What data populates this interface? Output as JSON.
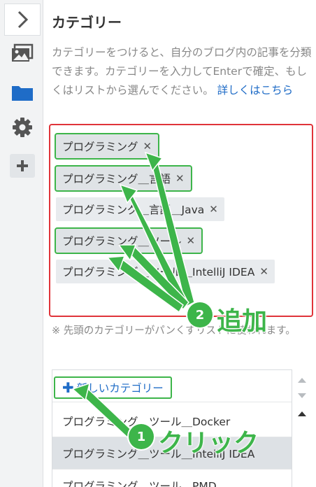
{
  "panel": {
    "title": "カテゴリー",
    "description": "カテゴリーをつけると、自分のブログ内の記事を分類できます。カテゴリーを入力してEnterで確定、もしくはリストから選んでください。",
    "help_link": "詳しくはこちら",
    "note": "※ 先頭のカテゴリーがパンくずリストに使われます。"
  },
  "toolbar": {
    "icons": [
      "chevron-right-icon",
      "image-icon",
      "folder-icon",
      "gear-icon",
      "plus-icon"
    ],
    "accent": "#1f6cc7"
  },
  "selected_tags": [
    {
      "label": "プログラミング",
      "remove": "✕"
    },
    {
      "label": "プログラミング＿言語",
      "remove": "✕"
    },
    {
      "label": "プログラミング＿言語＿Java",
      "remove": "✕"
    },
    {
      "label": "プログラミング＿ツール",
      "remove": "✕"
    },
    {
      "label": "プログラミング＿ツール＿IntelliJ IDEA",
      "remove": "✕"
    }
  ],
  "category_list": {
    "new_category_label": "新しいカテゴリー",
    "new_category_plus": "✚",
    "items": [
      "プログラミング＿ツール＿Docker",
      "プログラミング＿ツール＿IntelliJ IDEA",
      "プログラミング＿ツール＿PMD"
    ]
  },
  "annotations": {
    "step1_number": "1",
    "step1_label": "クリック",
    "step2_number": "2",
    "step2_label": "追加",
    "color": "#3db54a",
    "frame_color": "#e0343a"
  }
}
